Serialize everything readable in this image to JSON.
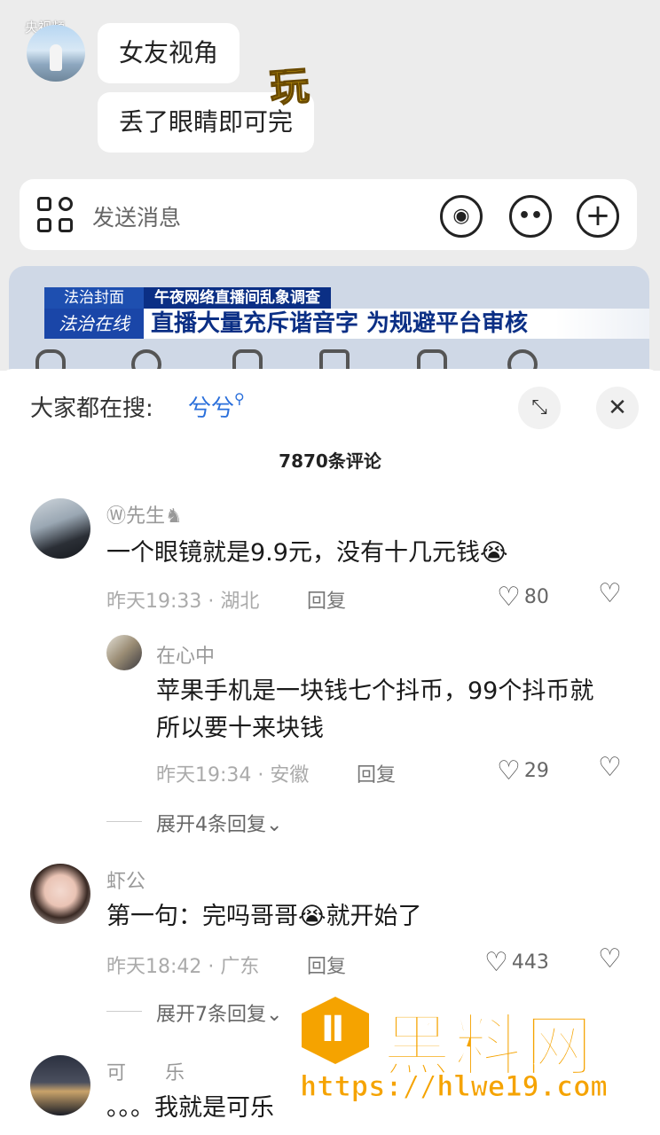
{
  "video": {
    "watermark": "央视频",
    "chat_messages": [
      "女友视角",
      "丢了眼睛即可完"
    ],
    "sticker_text": "玩",
    "input_placeholder": "发送消息",
    "news": {
      "tag_program": "法治封面",
      "tag_topic": "午夜网络直播间乱象调查",
      "tag_channel": "法治在线",
      "headline": "直播大量充斥谐音字 为规避平台审核"
    }
  },
  "header": {
    "hot_search_label": "大家都在搜:",
    "hot_search_term": "兮兮",
    "comment_count": "7870条评论"
  },
  "comments": [
    {
      "user": "Ⓦ先生♞",
      "text": "一个眼镜就是9.9元，没有十几元钱😭",
      "time_loc": "昨天19:33 · 湖北",
      "reply_label": "回复",
      "likes": "80",
      "replies": [
        {
          "user": "在心中",
          "text_line1": "苹果手机是一块钱七个抖币，99个抖币就",
          "text_line2": "所以要十来块钱",
          "time_loc": "昨天19:34 · 安徽",
          "reply_label": "回复",
          "likes": "29"
        }
      ],
      "expand": "展开4条回复⌄"
    },
    {
      "user": "虾公",
      "text": "第一句：完吗哥哥😭就开始了",
      "time_loc": "昨天18:42 · 广东",
      "reply_label": "回复",
      "likes": "443",
      "expand": "展开7条回复⌄"
    },
    {
      "user": "可　　乐",
      "text": "。。。我就是可乐"
    }
  ],
  "watermark": {
    "brand": "黑料网",
    "url": "https://hlwe19.com"
  },
  "colors": {
    "accent_blue": "#2a6fdb",
    "brand_orange": "#f5a300",
    "news_blue": "#0b2f85"
  }
}
